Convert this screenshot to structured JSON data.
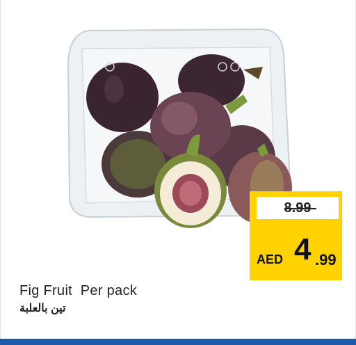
{
  "product": {
    "title_en": "Fig Fruit  Per pack",
    "title_ar": "تين بالعلبة",
    "image_description_icon": "fig-pack-image"
  },
  "price": {
    "old": "8.99",
    "currency": "AED",
    "current_main": "4",
    "current_decimal": ".99"
  },
  "colors": {
    "price_tag": "#ffd200",
    "bottom_bar": "#1d5aa7"
  }
}
